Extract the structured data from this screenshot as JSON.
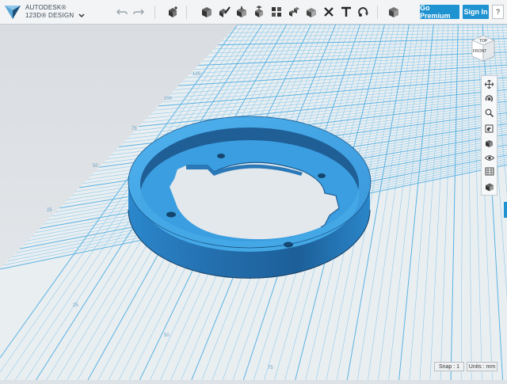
{
  "app": {
    "brand_line1": "AUTODESK®",
    "brand_line2": "123D® DESIGN"
  },
  "toolbar": {
    "go_premium": "Go Premium",
    "sign_in": "Sign In",
    "help": "?",
    "tools": [
      "undo-icon",
      "redo-icon",
      "new-object-icon",
      "primitives-icon",
      "sketch-icon",
      "construct-icon",
      "modify-icon",
      "pattern-icon",
      "grouping-icon",
      "combine-icon",
      "measure-icon",
      "text-icon",
      "snap-icon",
      "material-icon"
    ]
  },
  "viewcube": {
    "top": "TOP",
    "front": "FRONT"
  },
  "grid": {
    "labels_left": [
      "125",
      "100",
      "75",
      "50",
      "25"
    ],
    "labels_bottom": [
      "25",
      "50",
      "75"
    ]
  },
  "status": {
    "snap": "Snap : 1",
    "units": "Units : mm"
  },
  "colors": {
    "model": "#3aa2e4",
    "model_dark": "#1e6fb5",
    "grid": "#7ec5ea",
    "accent": "#1f93d1"
  }
}
